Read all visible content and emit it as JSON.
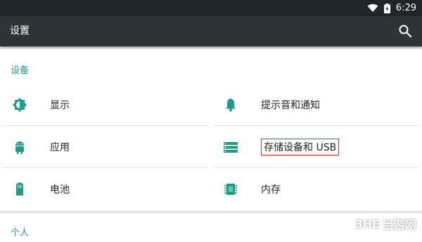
{
  "status_bar": {
    "time": "6:29"
  },
  "toolbar": {
    "title": "设置"
  },
  "sections": [
    {
      "header": "设备",
      "items": [
        {
          "label": "显示",
          "icon": "brightness-icon"
        },
        {
          "label": "提示音和通知",
          "icon": "bell-icon"
        },
        {
          "label": "应用",
          "icon": "android-icon"
        },
        {
          "label": "存储设备和 USB",
          "icon": "storage-icon"
        },
        {
          "label": "电池",
          "icon": "battery-icon"
        },
        {
          "label": "内存",
          "icon": "memory-icon"
        }
      ]
    },
    {
      "header": "个人"
    }
  ],
  "colors": {
    "accent": "#1f9a8b",
    "toolbar": "#2d3438",
    "status_bar": "#1f2528",
    "highlight": "#e0322e"
  },
  "watermark": {
    "logo": "3HE",
    "text": "当游网"
  }
}
